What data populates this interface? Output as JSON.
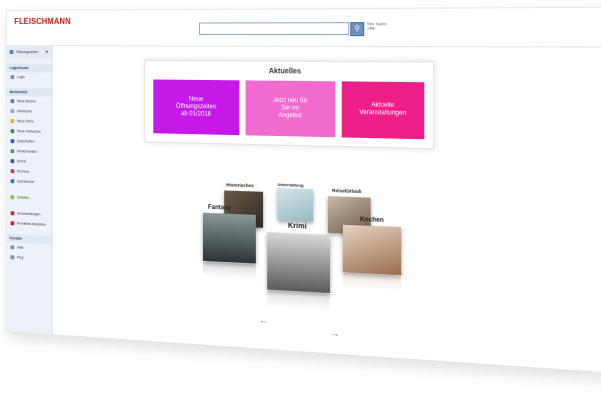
{
  "header": {
    "logo_text": "FLEISCHMANN",
    "logo_sub": "",
    "search_value": "",
    "search_button_icon": "search-icon",
    "search_option": "Erw. Suche",
    "search_option2": "Hilfe"
  },
  "sidebar": {
    "top": "Öffnungszeiten",
    "section1": "Login/Konto",
    "section1_items": [
      "Login"
    ],
    "section2": "Medienliste",
    "section2_items": [
      "Neue Bücher",
      "Hörbücher",
      "Neue Filme",
      "Neue Hörbücher",
      "Zeitschriften",
      "Kindermedien",
      "Krimis",
      "Romane",
      "Sachbücher"
    ],
    "section3_items": [
      "Onleihe"
    ],
    "section4_items": [
      "Veranstaltungen",
      "Fernleihe Anmelden"
    ],
    "section5": "Kontakt",
    "section5_items": [
      "Hilfe",
      "FAQ"
    ]
  },
  "aktuelles": {
    "title": "Aktuelles",
    "tiles": [
      {
        "label": "Neue\nÖffnungszeiten\nab 01/2018",
        "color": "#c419e8"
      },
      {
        "label": "Jetzt neu für\nSie im\nAngebot",
        "color": "#f06ad0"
      },
      {
        "label": "Aktuelle\nVeranstaltungen",
        "color": "#ec1e8a"
      }
    ]
  },
  "carousel": {
    "items": [
      "Historisches",
      "Unterhaltung",
      "Reise/Urlaub",
      "Fantasy",
      "Krimi",
      "Kochen"
    ],
    "prev_icon": "arrow-left-icon",
    "next_icon": "arrow-right-icon"
  }
}
